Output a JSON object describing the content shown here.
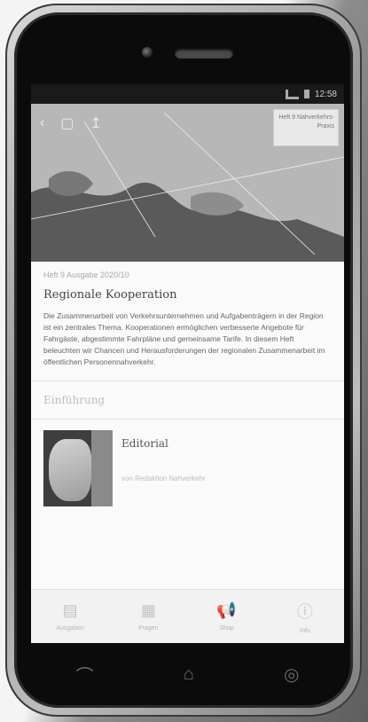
{
  "status_bar": {
    "time": "12:58"
  },
  "hero": {
    "back_label": "‹",
    "badge_text": "Heft 9 Nahverkehrs-Praxis"
  },
  "article": {
    "kicker": "Heft 9 Ausgabe 2020/10",
    "headline": "Regionale Kooperation",
    "body": "Die Zusammenarbeit von Verkehrsunternehmen und Aufgabenträgern in der Region ist ein zentrales Thema. Kooperationen ermöglichen verbesserte Angebote für Fahrgäste, abgestimmte Fahrpläne und gemeinsame Tarife. In diesem Heft beleuchten wir Chancen und Herausforderungen der regionalen Zusammenarbeit im öffentlichen Personennahverkehr."
  },
  "section": {
    "title": "Einführung"
  },
  "list": [
    {
      "title": "Editorial",
      "author": "von Redaktion Nahverkehr"
    }
  ],
  "bottom_nav": [
    {
      "label": "Ausgaben",
      "icon": "library-icon",
      "glyph": "▤"
    },
    {
      "label": "Fragen",
      "icon": "grid-icon",
      "glyph": "▦"
    },
    {
      "label": "Shop",
      "icon": "megaphone-icon",
      "glyph": "📢"
    },
    {
      "label": "Info",
      "icon": "info-icon",
      "glyph": "ⓘ"
    }
  ],
  "hardware": {
    "back": "⌒",
    "home": "⌂",
    "recent": "◎"
  }
}
